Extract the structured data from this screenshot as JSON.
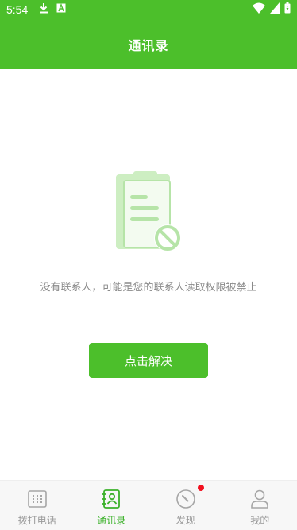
{
  "status_bar": {
    "time": "5:54",
    "icons": [
      "download-icon",
      "font-icon",
      "wifi-icon",
      "signal-icon",
      "battery-icon"
    ]
  },
  "app_bar": {
    "title": "通讯录"
  },
  "empty_state": {
    "illustration": "clipboard-blocked-icon",
    "message": "没有联系人，可能是您的联系人读取权限被禁止",
    "action_label": "点击解决"
  },
  "bottom_nav": {
    "items": [
      {
        "label": "拨打电话",
        "icon": "dialpad-icon",
        "active": false
      },
      {
        "label": "通讯录",
        "icon": "contacts-book-icon",
        "active": true
      },
      {
        "label": "发现",
        "icon": "compass-icon",
        "active": false,
        "badge": true
      },
      {
        "label": "我的",
        "icon": "person-icon",
        "active": false
      }
    ]
  },
  "colors": {
    "primary": "#4cbf2b",
    "active_label": "#3bb12a",
    "inactive": "#9a9a9a",
    "message_text": "#8a8a8a",
    "badge": "#f2101f",
    "illustration_light": "#cdeec2"
  }
}
